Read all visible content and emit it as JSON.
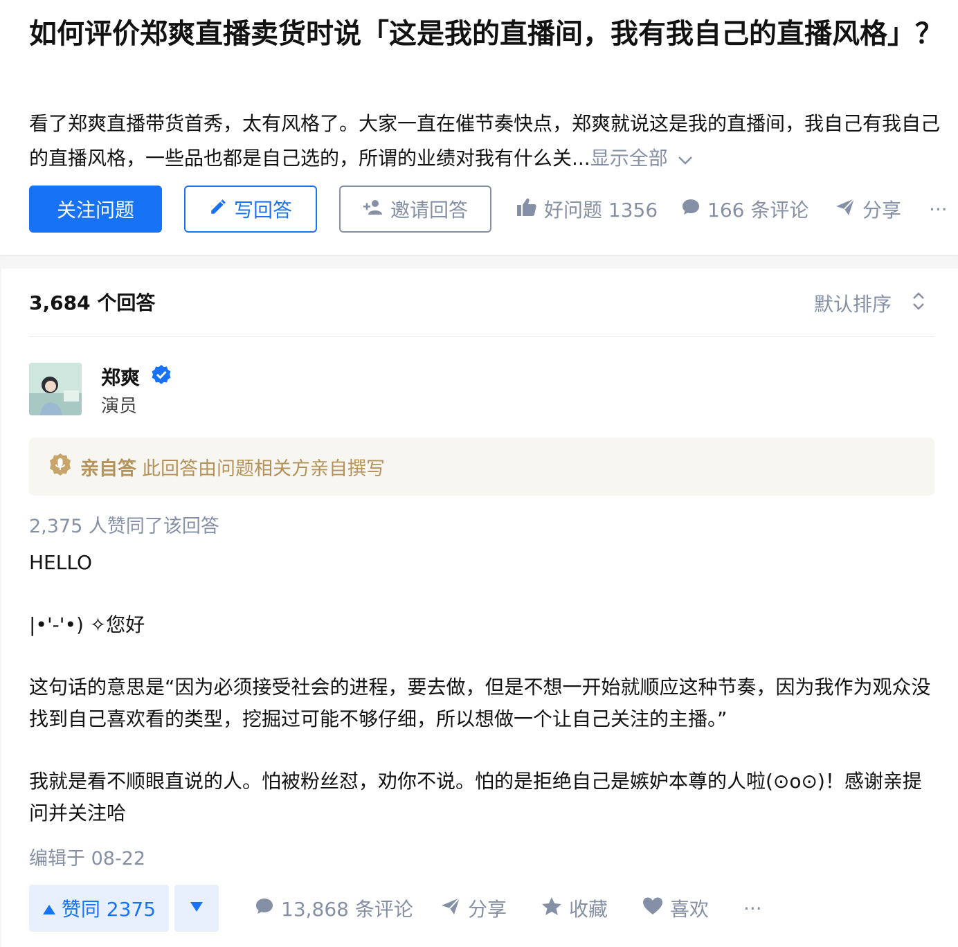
{
  "question": {
    "title": "如何评价郑爽直播卖货时说「这是我的直播间，我有我自己的直播风格」？",
    "description": "看了郑爽直播带货首秀，太有风格了。大家一直在催节奏快点，郑爽就说这是我的直播间，我自己有我自己的直播风格，一些品也都是自己选的，所谓的业绩对我有什么关...",
    "show_all": "显示全部",
    "follow_button": "关注问题",
    "write_button": "写回答",
    "invite_button": "邀请回答",
    "good_question": "好问题 1356",
    "comments": "166 条评论",
    "share": "分享",
    "more": "···"
  },
  "answers": {
    "count_label": "3,684 个回答",
    "sort_label": "默认排序"
  },
  "answer": {
    "author_name": "郑爽",
    "author_headline": "演员",
    "personal_tag": "亲自答",
    "personal_text": "此回答由问题相关方亲自撰写",
    "voters": "2,375 人赞同了该回答",
    "paragraphs": [
      "HELLO",
      "|•'-'•) ✧您好",
      "这句话的意思是“因为必须接受社会的进程，要去做，但是不想一开始就顺应这种节奏，因为我作为观众没找到自己喜欢看的类型，挖掘过可能不够仔细，所以想做一个让自己关注的主播。”",
      "我就是看不顺眼直说的人。怕被粉丝怼，劝你不说。怕的是拒绝自己是嫉妒本尊的人啦(⊙o⊙)！感谢亲提问并关注哈"
    ],
    "edited": "编辑于 08-22",
    "vote_up": "赞同 2375",
    "comments": "13,868 条评论",
    "share": "分享",
    "collect": "收藏",
    "like": "喜欢",
    "more": "···"
  }
}
